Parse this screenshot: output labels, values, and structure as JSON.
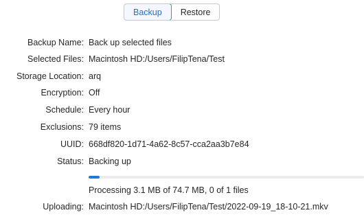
{
  "tabs": [
    {
      "label": "Backup",
      "active": true
    },
    {
      "label": "Restore",
      "active": false
    }
  ],
  "fields": {
    "backup_name": {
      "label": "Backup Name:",
      "value": "Back up selected files"
    },
    "selected_files": {
      "label": "Selected Files:",
      "value": "Macintosh HD:/Users/FilipTena/Test"
    },
    "storage_location": {
      "label": "Storage Location:",
      "value": "arq"
    },
    "encryption": {
      "label": "Encryption:",
      "value": "Off"
    },
    "schedule": {
      "label": "Schedule:",
      "value": "Every hour"
    },
    "exclusions": {
      "label": "Exclusions:",
      "value": "79 items"
    },
    "uuid": {
      "label": "UUID:",
      "value": "668df820-1d71-4a62-8c57-cca2aa3b7e84"
    },
    "status": {
      "label": "Status:",
      "value": "Backing up"
    }
  },
  "progress": {
    "fraction": 0.041,
    "text": "Processing 3.1 MB of 74.7 MB, 0 of 1 files"
  },
  "uploading": {
    "label": "Uploading:",
    "value": "Macintosh HD:/Users/FilipTena/Test/2022-09-19_18-10-21.mkv"
  },
  "colors": {
    "accent": "#1e78e6"
  }
}
